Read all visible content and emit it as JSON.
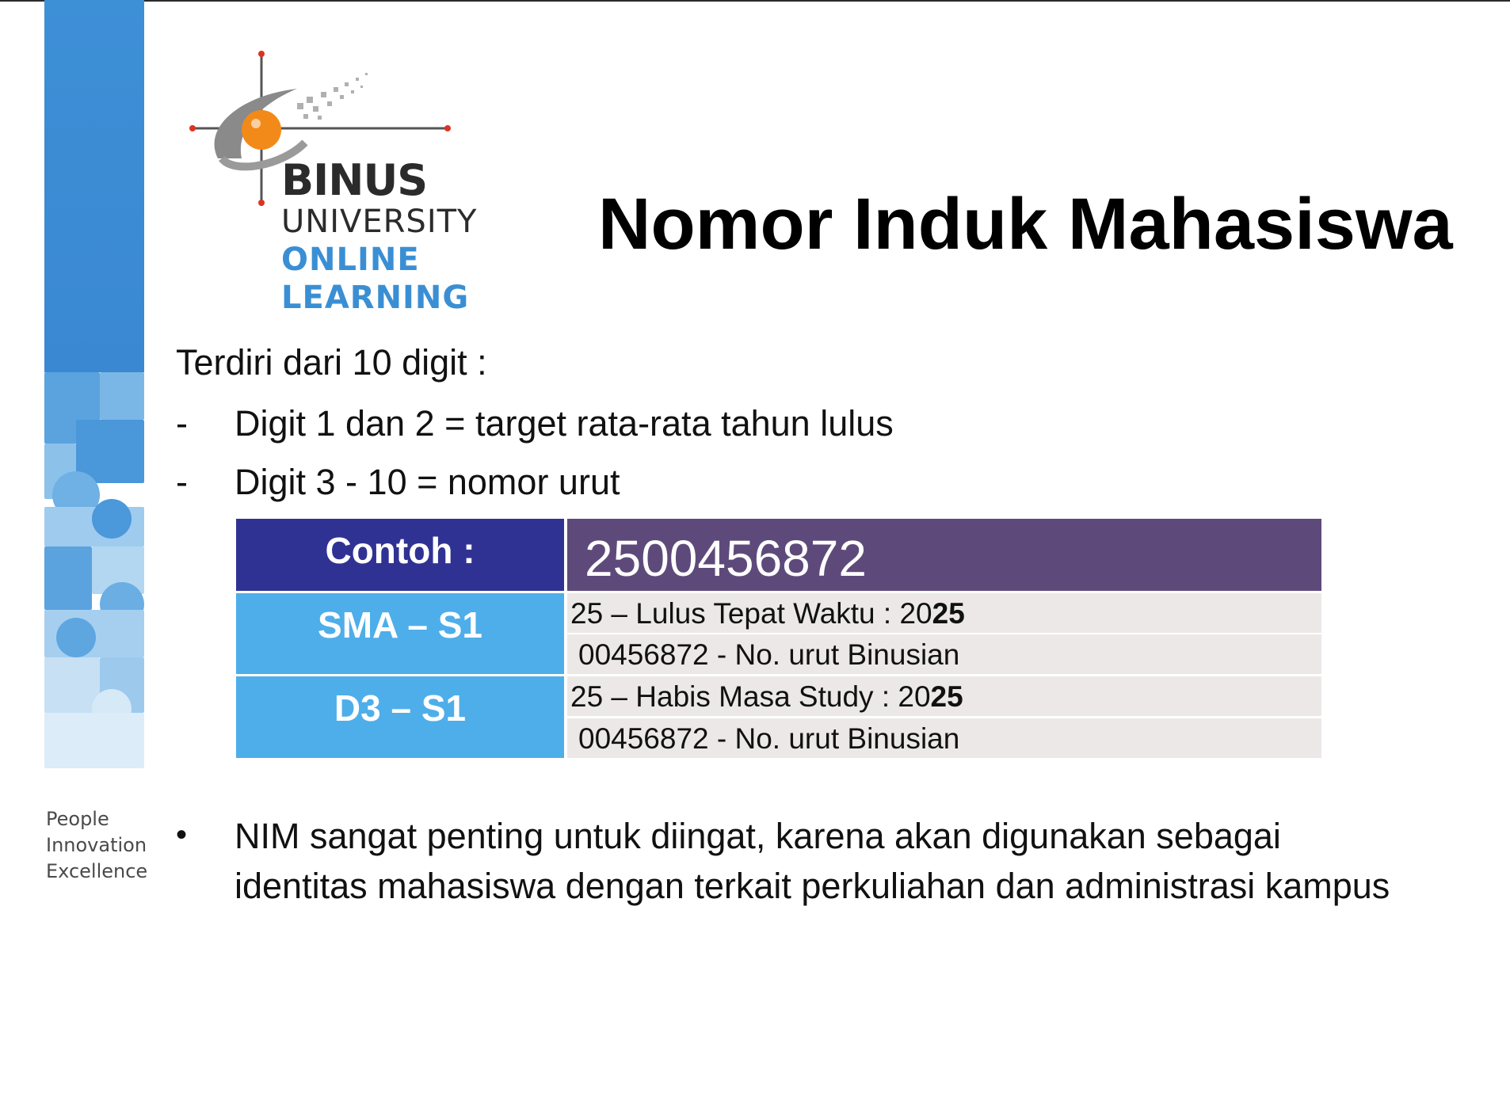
{
  "logo": {
    "line1": "BINUS",
    "line2": "UNIVERSITY",
    "line3": "ONLINE",
    "line4": "LEARNING"
  },
  "tagline": [
    "People",
    "Innovation",
    "Excellence"
  ],
  "title": "Nomor Induk Mahasiswa",
  "lead": "Terdiri dari 10 digit :",
  "dash_items": [
    {
      "marker": "-",
      "text": "Digit 1 dan 2 = target rata-rata tahun lulus"
    },
    {
      "marker": "-",
      "text": "Digit 3 - 10 = nomor urut"
    }
  ],
  "table": {
    "header_label": "Contoh :",
    "header_value": "2500456872",
    "rows": [
      {
        "label": "SMA – S1",
        "line1_prefix": "25 – Lulus Tepat Waktu : 20",
        "line1_bold": "25",
        "line2": "00456872 - No. urut Binusian"
      },
      {
        "label": "D3 – S1",
        "line1_prefix": "25 – Habis Masa Study : 20",
        "line1_bold": "25",
        "line2": "00456872 - No. urut Binusian"
      }
    ]
  },
  "bullet": {
    "marker": "•",
    "text": "NIM sangat penting untuk diingat, karena akan digunakan sebagai identitas mahasiswa dengan terkait perkuliahan dan administrasi kampus"
  }
}
